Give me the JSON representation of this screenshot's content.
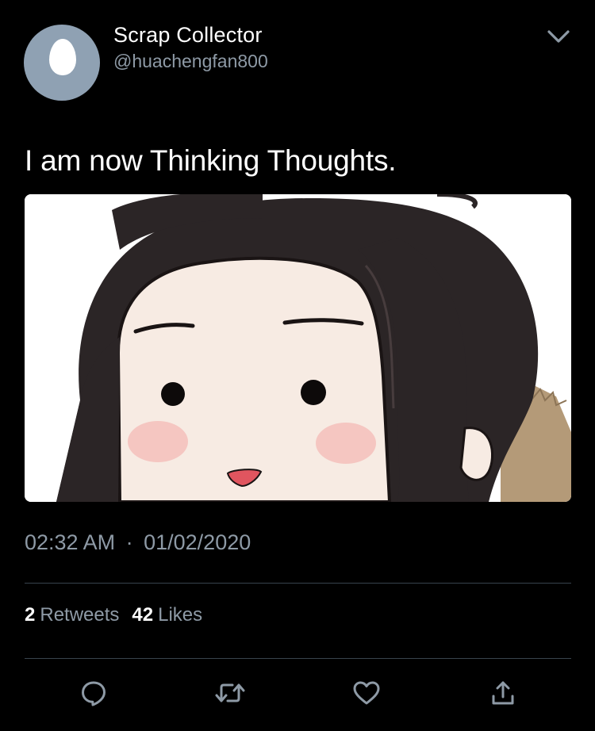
{
  "author": {
    "display_name": "Scrap Collector",
    "handle": "@huachengfan800"
  },
  "tweet": {
    "text": "I am now Thinking Thoughts.",
    "time": "02:32 AM",
    "separator": "·",
    "date": "01/02/2020"
  },
  "stats": {
    "retweets_count": "2",
    "retweets_label": "Retweets",
    "likes_count": "42",
    "likes_label": "Likes"
  },
  "icons": {
    "more": "chevron-down-icon",
    "reply": "reply-icon",
    "retweet": "retweet-icon",
    "like": "heart-icon",
    "share": "share-icon"
  },
  "colors": {
    "background": "#000000",
    "text": "#ffffff",
    "secondary_text": "#8e9aa6",
    "divider": "#38444d",
    "avatar_bg": "#8fa1b3"
  }
}
